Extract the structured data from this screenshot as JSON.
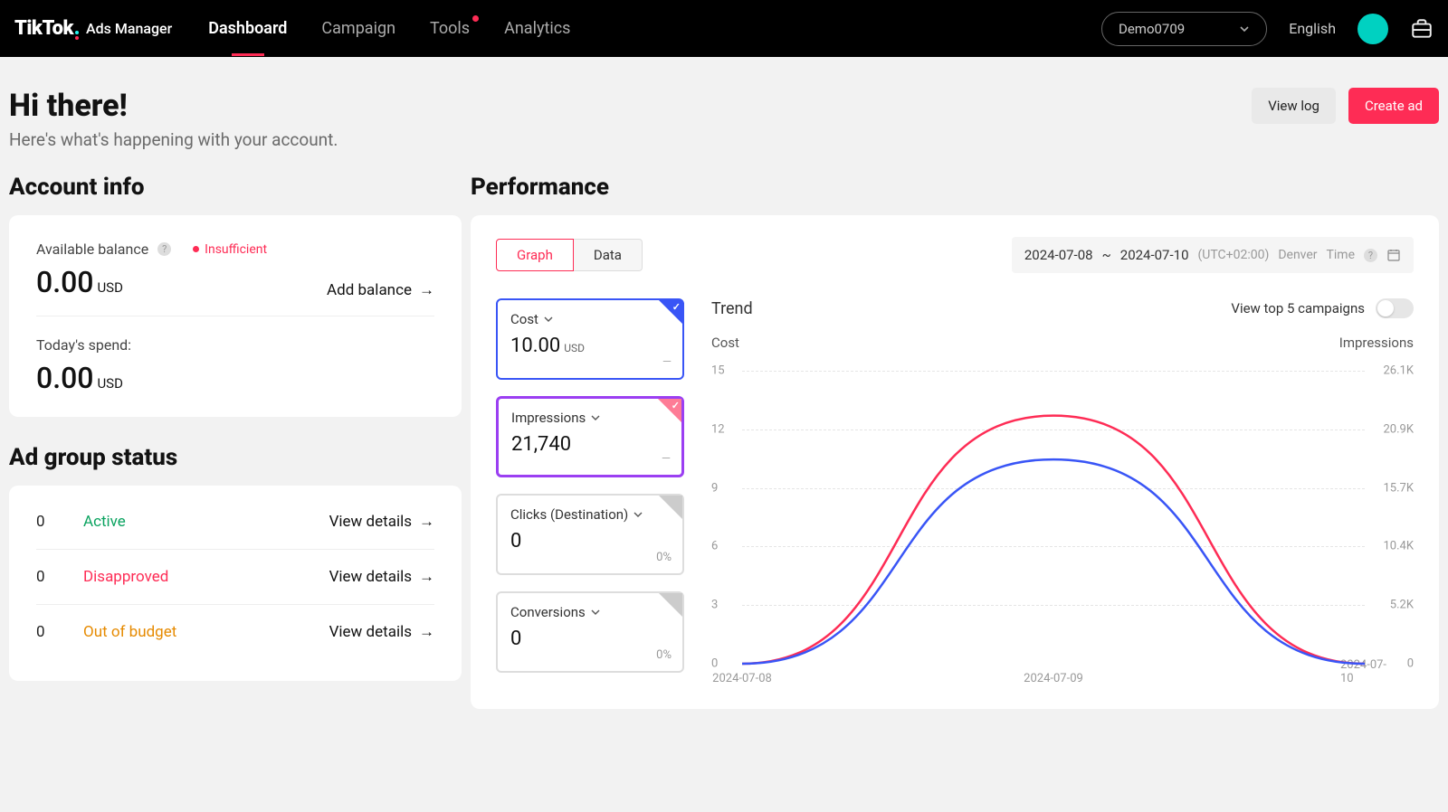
{
  "header": {
    "brand": "TikTok",
    "brand_sub": "Ads Manager",
    "nav": {
      "dashboard": "Dashboard",
      "campaign": "Campaign",
      "tools": "Tools",
      "analytics": "Analytics"
    },
    "account_name": "Demo0709",
    "language": "English"
  },
  "page": {
    "greeting": "Hi there!",
    "subgreeting": "Here's what's happening with your account.",
    "view_log_label": "View log",
    "create_ad_label": "Create ad"
  },
  "account_info": {
    "section_title": "Account info",
    "available_label": "Available balance",
    "insufficient_label": "Insufficient",
    "available_value": "0.00",
    "available_currency": "USD",
    "add_balance_label": "Add balance",
    "today_spend_label": "Today's spend:",
    "today_spend_value": "0.00",
    "today_spend_currency": "USD"
  },
  "ad_group_status": {
    "section_title": "Ad group status",
    "view_details_label": "View details",
    "rows": [
      {
        "count": "0",
        "status": "Active"
      },
      {
        "count": "0",
        "status": "Disapproved"
      },
      {
        "count": "0",
        "status": "Out of budget"
      }
    ]
  },
  "performance": {
    "section_title": "Performance",
    "tab_graph": "Graph",
    "tab_data": "Data",
    "date_from": "2024-07-08",
    "date_sep": "~",
    "date_to": "2024-07-10",
    "tz": "(UTC+02:00)",
    "city": "Denver",
    "time_label": "Time",
    "trend_title": "Trend",
    "view_top_label": "View top 5 campaigns",
    "left_axis_label": "Cost",
    "right_axis_label": "Impressions",
    "metrics": {
      "cost": {
        "name": "Cost",
        "value": "10.00",
        "currency": "USD",
        "foot": "—"
      },
      "impressions": {
        "name": "Impressions",
        "value": "21,740",
        "foot": "—"
      },
      "clicks": {
        "name": "Clicks (Destination)",
        "value": "0",
        "foot": "0%"
      },
      "conversions": {
        "name": "Conversions",
        "value": "0",
        "foot": "0%"
      }
    }
  },
  "chart_data": {
    "type": "line",
    "x": [
      "2024-07-08",
      "2024-07-09",
      "2024-07-10"
    ],
    "series": [
      {
        "name": "Cost",
        "axis": "left",
        "color": "#FE2C55",
        "values": [
          0,
          12.7,
          0
        ]
      },
      {
        "name": "Impressions",
        "axis": "right",
        "color": "#3955f6",
        "values": [
          0,
          18200,
          0
        ]
      }
    ],
    "yl": {
      "label": "Cost",
      "ticks": [
        "0",
        "3",
        "6",
        "9",
        "12",
        "15"
      ],
      "range": [
        0,
        15
      ]
    },
    "yr": {
      "label": "Impressions",
      "ticks": [
        "0",
        "5.2K",
        "10.4K",
        "15.7K",
        "20.9K",
        "26.1K"
      ],
      "range": [
        0,
        26100
      ]
    }
  }
}
